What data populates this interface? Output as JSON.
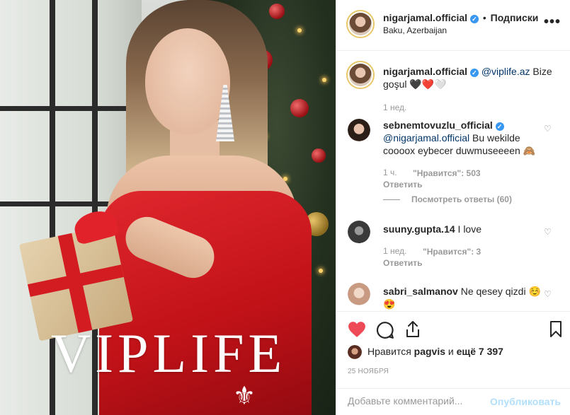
{
  "photo": {
    "watermark": "VIPLIFE"
  },
  "header": {
    "username": "nigarjamal.official",
    "separator": "•",
    "follow_label": "Подписки",
    "location": "Baku, Azerbaijan",
    "more": "•••"
  },
  "caption": {
    "username": "nigarjamal.official",
    "mention": "@viplife.az",
    "text": " Bize goşul 🖤❤️🤍",
    "time": "1 нед."
  },
  "comments": [
    {
      "username": "sebnemtovuzlu_official",
      "mention": "@nigarjamal.official",
      "text": " Bu wekilde coooox eybecer duwmuseeeen 🙈",
      "time": "1 ч.",
      "likes": "\"Нравится\": 503",
      "reply": "Ответить",
      "view_replies": "Посмотреть ответы (60)"
    },
    {
      "username": "suuny.gupta.14",
      "text": " I love",
      "time": "1 нед.",
      "likes": "\"Нравится\": 3",
      "reply": "Ответить"
    },
    {
      "username": "sabri_salmanov",
      "text": " Ne qesey qizdi ☺️ 😍"
    }
  ],
  "actions": {
    "liked_by_prefix": "Нравится ",
    "liked_by_user": "pagvis",
    "liked_by_suffix": " и ",
    "others": "ещё 7 397",
    "date": "25 НОЯБРЯ"
  },
  "add_comment": {
    "placeholder": "Добавьте комментарий...",
    "post_label": "Опубликовать"
  },
  "colors": {
    "accent_blue": "#3897f0",
    "like_red": "#ed4956",
    "mention": "#003569"
  }
}
